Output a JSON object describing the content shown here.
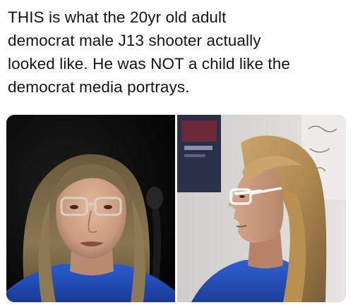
{
  "post": {
    "text_lines": [
      "THIS is what the 20yr old adult",
      "democrat male J13 shooter actually",
      "looked like. He was NOT a child like the",
      "democrat media portrays."
    ]
  },
  "media": {
    "images": [
      {
        "subject": "man-with-glasses-facing-camera",
        "background_color": "#070707",
        "shirt_color": "#1f4fc2"
      },
      {
        "subject": "man-with-glasses-profile-view",
        "background_color": "#d8d6d2",
        "shirt_color": "#2a55c8"
      }
    ]
  }
}
